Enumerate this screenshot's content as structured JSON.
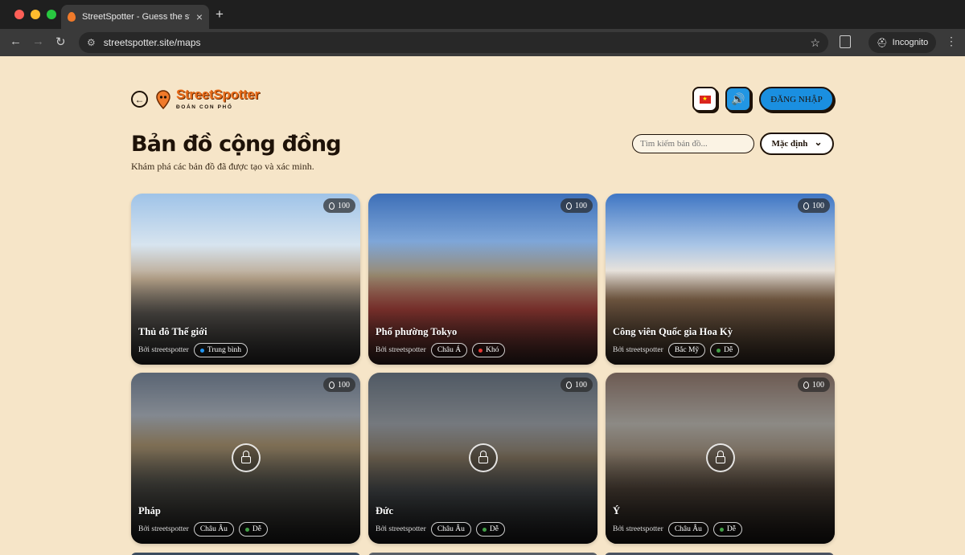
{
  "browser": {
    "tab_title": "StreetSpotter - Guess the str",
    "url": "streetspotter.site/maps",
    "incognito_label": "Incognito",
    "traffic_colors": [
      "#fe5f57",
      "#febc2e",
      "#28c840"
    ]
  },
  "header": {
    "logo_text": "StreetSpotter",
    "logo_sub": "ĐOÁN CON PHỐ",
    "login_label": "ĐĂNG NHẬP",
    "flag_text": "★",
    "sound_icon": "🔊"
  },
  "page": {
    "title": "Bản đồ cộng đồng",
    "subtitle": "Khám phá các bản đồ đã được tạo và xác minh.",
    "search_placeholder": "Tìm kiếm bản đồ...",
    "sort_label": "Mặc định",
    "sort_chevron": "⌄"
  },
  "cards": [
    {
      "title": "Thủ đô Thế giới",
      "by": "Bởi streetspotter",
      "count": "100",
      "tags": [
        {
          "label": "Trung bình",
          "dot": "#2196f3"
        }
      ],
      "locked": false
    },
    {
      "title": "Phố phường Tokyo",
      "by": "Bởi streetspotter",
      "count": "100",
      "tags": [
        {
          "label": "Châu Á",
          "dot": ""
        },
        {
          "label": "Khó",
          "dot": "#e53935"
        }
      ],
      "locked": false
    },
    {
      "title": "Công viên Quốc gia Hoa Kỳ",
      "by": "Bởi streetspotter",
      "count": "100",
      "tags": [
        {
          "label": "Bắc Mỹ",
          "dot": ""
        },
        {
          "label": "Dễ",
          "dot": "#43a047"
        }
      ],
      "locked": false
    },
    {
      "title": "Pháp",
      "by": "Bởi streetspotter",
      "count": "100",
      "tags": [
        {
          "label": "Châu Âu",
          "dot": ""
        },
        {
          "label": "Dễ",
          "dot": "#43a047"
        }
      ],
      "locked": true
    },
    {
      "title": "Đức",
      "by": "Bởi streetspotter",
      "count": "100",
      "tags": [
        {
          "label": "Châu Âu",
          "dot": ""
        },
        {
          "label": "Dễ",
          "dot": "#43a047"
        }
      ],
      "locked": true
    },
    {
      "title": "Ý",
      "by": "Bởi streetspotter",
      "count": "100",
      "tags": [
        {
          "label": "Châu Âu",
          "dot": ""
        },
        {
          "label": "Dễ",
          "dot": "#43a047"
        }
      ],
      "locked": true
    }
  ]
}
